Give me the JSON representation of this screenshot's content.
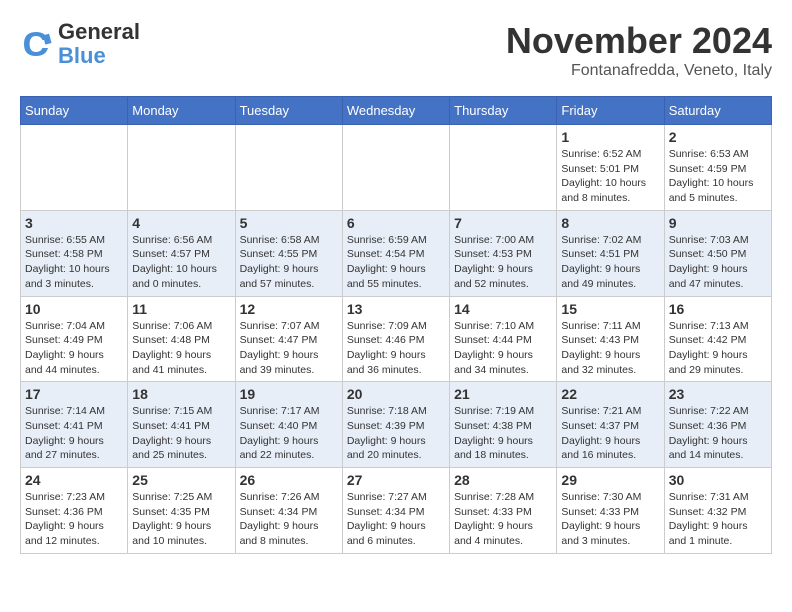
{
  "logo": {
    "line1": "General",
    "line2": "Blue"
  },
  "title": "November 2024",
  "location": "Fontanafredda, Veneto, Italy",
  "headers": [
    "Sunday",
    "Monday",
    "Tuesday",
    "Wednesday",
    "Thursday",
    "Friday",
    "Saturday"
  ],
  "weeks": [
    [
      {
        "day": "",
        "info": ""
      },
      {
        "day": "",
        "info": ""
      },
      {
        "day": "",
        "info": ""
      },
      {
        "day": "",
        "info": ""
      },
      {
        "day": "",
        "info": ""
      },
      {
        "day": "1",
        "info": "Sunrise: 6:52 AM\nSunset: 5:01 PM\nDaylight: 10 hours and 8 minutes."
      },
      {
        "day": "2",
        "info": "Sunrise: 6:53 AM\nSunset: 4:59 PM\nDaylight: 10 hours and 5 minutes."
      }
    ],
    [
      {
        "day": "3",
        "info": "Sunrise: 6:55 AM\nSunset: 4:58 PM\nDaylight: 10 hours and 3 minutes."
      },
      {
        "day": "4",
        "info": "Sunrise: 6:56 AM\nSunset: 4:57 PM\nDaylight: 10 hours and 0 minutes."
      },
      {
        "day": "5",
        "info": "Sunrise: 6:58 AM\nSunset: 4:55 PM\nDaylight: 9 hours and 57 minutes."
      },
      {
        "day": "6",
        "info": "Sunrise: 6:59 AM\nSunset: 4:54 PM\nDaylight: 9 hours and 55 minutes."
      },
      {
        "day": "7",
        "info": "Sunrise: 7:00 AM\nSunset: 4:53 PM\nDaylight: 9 hours and 52 minutes."
      },
      {
        "day": "8",
        "info": "Sunrise: 7:02 AM\nSunset: 4:51 PM\nDaylight: 9 hours and 49 minutes."
      },
      {
        "day": "9",
        "info": "Sunrise: 7:03 AM\nSunset: 4:50 PM\nDaylight: 9 hours and 47 minutes."
      }
    ],
    [
      {
        "day": "10",
        "info": "Sunrise: 7:04 AM\nSunset: 4:49 PM\nDaylight: 9 hours and 44 minutes."
      },
      {
        "day": "11",
        "info": "Sunrise: 7:06 AM\nSunset: 4:48 PM\nDaylight: 9 hours and 41 minutes."
      },
      {
        "day": "12",
        "info": "Sunrise: 7:07 AM\nSunset: 4:47 PM\nDaylight: 9 hours and 39 minutes."
      },
      {
        "day": "13",
        "info": "Sunrise: 7:09 AM\nSunset: 4:46 PM\nDaylight: 9 hours and 36 minutes."
      },
      {
        "day": "14",
        "info": "Sunrise: 7:10 AM\nSunset: 4:44 PM\nDaylight: 9 hours and 34 minutes."
      },
      {
        "day": "15",
        "info": "Sunrise: 7:11 AM\nSunset: 4:43 PM\nDaylight: 9 hours and 32 minutes."
      },
      {
        "day": "16",
        "info": "Sunrise: 7:13 AM\nSunset: 4:42 PM\nDaylight: 9 hours and 29 minutes."
      }
    ],
    [
      {
        "day": "17",
        "info": "Sunrise: 7:14 AM\nSunset: 4:41 PM\nDaylight: 9 hours and 27 minutes."
      },
      {
        "day": "18",
        "info": "Sunrise: 7:15 AM\nSunset: 4:41 PM\nDaylight: 9 hours and 25 minutes."
      },
      {
        "day": "19",
        "info": "Sunrise: 7:17 AM\nSunset: 4:40 PM\nDaylight: 9 hours and 22 minutes."
      },
      {
        "day": "20",
        "info": "Sunrise: 7:18 AM\nSunset: 4:39 PM\nDaylight: 9 hours and 20 minutes."
      },
      {
        "day": "21",
        "info": "Sunrise: 7:19 AM\nSunset: 4:38 PM\nDaylight: 9 hours and 18 minutes."
      },
      {
        "day": "22",
        "info": "Sunrise: 7:21 AM\nSunset: 4:37 PM\nDaylight: 9 hours and 16 minutes."
      },
      {
        "day": "23",
        "info": "Sunrise: 7:22 AM\nSunset: 4:36 PM\nDaylight: 9 hours and 14 minutes."
      }
    ],
    [
      {
        "day": "24",
        "info": "Sunrise: 7:23 AM\nSunset: 4:36 PM\nDaylight: 9 hours and 12 minutes."
      },
      {
        "day": "25",
        "info": "Sunrise: 7:25 AM\nSunset: 4:35 PM\nDaylight: 9 hours and 10 minutes."
      },
      {
        "day": "26",
        "info": "Sunrise: 7:26 AM\nSunset: 4:34 PM\nDaylight: 9 hours and 8 minutes."
      },
      {
        "day": "27",
        "info": "Sunrise: 7:27 AM\nSunset: 4:34 PM\nDaylight: 9 hours and 6 minutes."
      },
      {
        "day": "28",
        "info": "Sunrise: 7:28 AM\nSunset: 4:33 PM\nDaylight: 9 hours and 4 minutes."
      },
      {
        "day": "29",
        "info": "Sunrise: 7:30 AM\nSunset: 4:33 PM\nDaylight: 9 hours and 3 minutes."
      },
      {
        "day": "30",
        "info": "Sunrise: 7:31 AM\nSunset: 4:32 PM\nDaylight: 9 hours and 1 minute."
      }
    ]
  ]
}
